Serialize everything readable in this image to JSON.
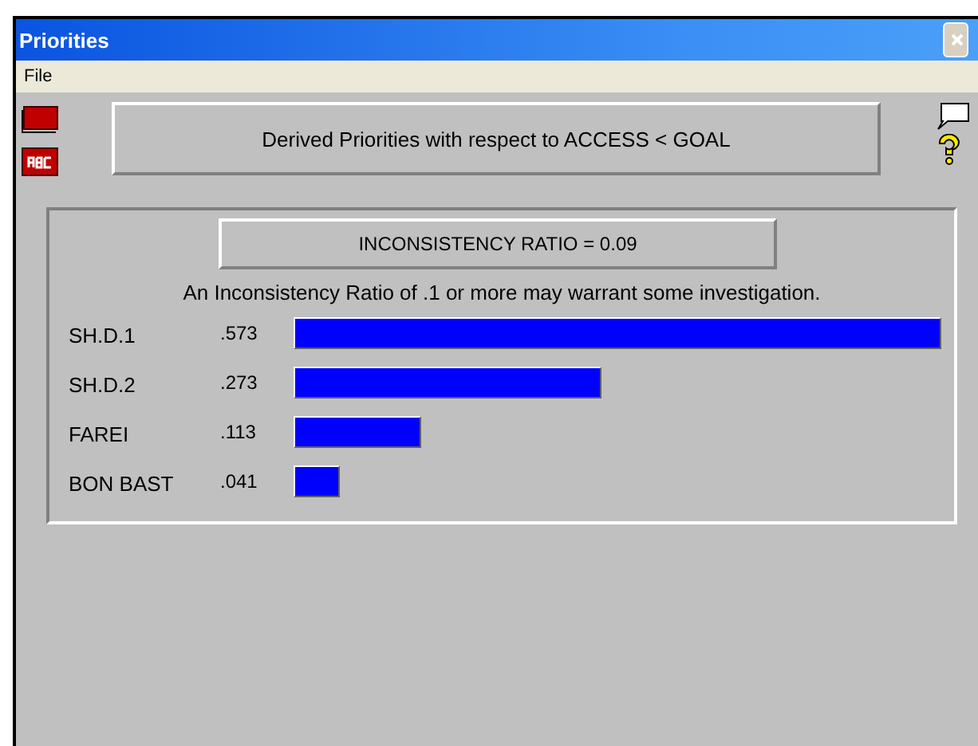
{
  "window": {
    "title": "Priorities"
  },
  "menu": [
    "File"
  ],
  "header": "Derived Priorities with respect to ACCESS < GOAL",
  "inconsistency_ratio": "INCONSISTENCY RATIO = 0.09",
  "note": "An Inconsistency Ratio of .1 or more may warrant some investigation.",
  "priorities": [
    {
      "name": "SH.D.1",
      "value": ".573"
    },
    {
      "name": "SH.D.2",
      "value": ".273"
    },
    {
      "name": "FAREI",
      "value": ".113"
    },
    {
      "name": "BON BAST",
      "value": ".041"
    }
  ]
}
